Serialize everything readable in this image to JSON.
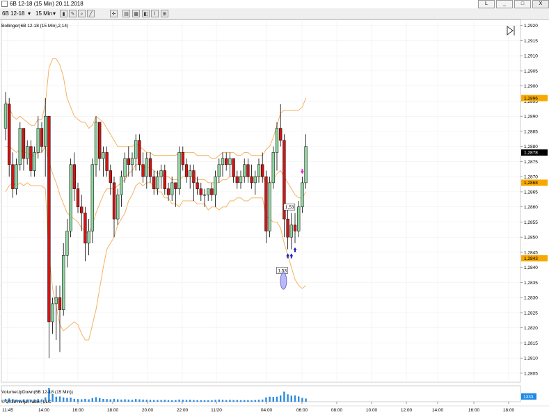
{
  "window": {
    "title": "6B 12-18 (15 Min)  20.11.2018",
    "controls": [
      "L",
      "_",
      "□",
      "X"
    ]
  },
  "toolbar": {
    "instrument": "6B 12-18",
    "interval": "15 Min"
  },
  "colors": {
    "up": "#8fd4a0",
    "down": "#d01414",
    "band": "#f5b262",
    "price_tag": "#f7a900",
    "last_tag": "#000000",
    "volume": "#2f8ae0",
    "volume_tag": "#1c8ae6",
    "up_arrow": "#2020c0",
    "down_arrow": "#e020e0"
  },
  "chart_data": [
    {
      "type": "candlestick",
      "indicator_label": "Bollinger(6B 12-18 (15 Min),2,14)",
      "ylim": [
        1.2802,
        1.2922
      ],
      "y_ticks": [
        "1,2920",
        "1,2915",
        "1,2910",
        "1,2905",
        "1,2900",
        "1,2895",
        "1,2890",
        "1,2885",
        "1,2880",
        "1,2875",
        "1,2870",
        "1,2865",
        "1,2860",
        "1,2855",
        "1,2850",
        "1,2845",
        "1,2840",
        "1,2835",
        "1,2830",
        "1,2825",
        "1,2820",
        "1,2815",
        "1,2810",
        "1,2805"
      ],
      "x_ticks": [
        "11:45",
        "14:00",
        "16:00",
        "18:00",
        "20:00",
        "22:00",
        "11/20",
        "04:00",
        "06:00",
        "08:00",
        "10:00",
        "12:00",
        "14:00",
        "16:00",
        "18:00"
      ],
      "price_tags": {
        "upper_band": "1,2896",
        "middle_band": "1,2868",
        "lower_band": "1,2843",
        "last": "1,2878"
      },
      "order_labels": [
        "1,53",
        "1,53"
      ],
      "candles": [
        [
          1.2886,
          1.2898,
          1.2882,
          1.2894
        ],
        [
          1.2894,
          1.2896,
          1.287,
          1.2874
        ],
        [
          1.2874,
          1.2878,
          1.2863,
          1.2866
        ],
        [
          1.2866,
          1.2876,
          1.2864,
          1.2874
        ],
        [
          1.2874,
          1.2888,
          1.2872,
          1.2886
        ],
        [
          1.2886,
          1.2886,
          1.2872,
          1.2876
        ],
        [
          1.2876,
          1.2882,
          1.2874,
          1.288
        ],
        [
          1.288,
          1.2882,
          1.287,
          1.2872
        ],
        [
          1.2872,
          1.288,
          1.287,
          1.2878
        ],
        [
          1.2878,
          1.289,
          1.2876,
          1.2886
        ],
        [
          1.2886,
          1.2888,
          1.2878,
          1.288
        ],
        [
          1.288,
          1.2896,
          1.287,
          1.289
        ],
        [
          1.289,
          1.289,
          1.281,
          1.2822
        ],
        [
          1.2822,
          1.283,
          1.2818,
          1.2828
        ],
        [
          1.2828,
          1.2834,
          1.2816,
          1.283
        ],
        [
          1.283,
          1.2834,
          1.2812,
          1.2826
        ],
        [
          1.2826,
          1.2848,
          1.2824,
          1.2844
        ],
        [
          1.2844,
          1.2856,
          1.284,
          1.2852
        ],
        [
          1.2852,
          1.2876,
          1.285,
          1.2874
        ],
        [
          1.2874,
          1.2878,
          1.2862,
          1.2866
        ],
        [
          1.2866,
          1.2868,
          1.2858,
          1.286
        ],
        [
          1.286,
          1.2864,
          1.2852,
          1.2858
        ],
        [
          1.2858,
          1.286,
          1.2842,
          1.2848
        ],
        [
          1.2848,
          1.2856,
          1.2844,
          1.2852
        ],
        [
          1.2852,
          1.2876,
          1.2848,
          1.2874
        ],
        [
          1.2874,
          1.289,
          1.287,
          1.2888
        ],
        [
          1.2888,
          1.2888,
          1.2872,
          1.2876
        ],
        [
          1.2876,
          1.288,
          1.287,
          1.2878
        ],
        [
          1.2878,
          1.288,
          1.287,
          1.2872
        ],
        [
          1.2872,
          1.2874,
          1.2864,
          1.2868
        ],
        [
          1.2868,
          1.287,
          1.285,
          1.2856
        ],
        [
          1.2856,
          1.2866,
          1.2854,
          1.2864
        ],
        [
          1.2864,
          1.2872,
          1.286,
          1.287
        ],
        [
          1.287,
          1.2878,
          1.2868,
          1.2876
        ],
        [
          1.2876,
          1.288,
          1.287,
          1.2874
        ],
        [
          1.2874,
          1.2878,
          1.287,
          1.2876
        ],
        [
          1.2876,
          1.2884,
          1.2872,
          1.2882
        ],
        [
          1.2882,
          1.2884,
          1.2872,
          1.2874
        ],
        [
          1.2874,
          1.2878,
          1.2868,
          1.287
        ],
        [
          1.287,
          1.2878,
          1.2866,
          1.2876
        ],
        [
          1.2876,
          1.2878,
          1.2868,
          1.287
        ],
        [
          1.287,
          1.2872,
          1.2864,
          1.2866
        ],
        [
          1.2866,
          1.2872,
          1.2864,
          1.287
        ],
        [
          1.287,
          1.2874,
          1.2866,
          1.2872
        ],
        [
          1.2872,
          1.2874,
          1.2864,
          1.2866
        ],
        [
          1.2866,
          1.2868,
          1.2862,
          1.2864
        ],
        [
          1.2864,
          1.287,
          1.2862,
          1.2868
        ],
        [
          1.2868,
          1.2868,
          1.286,
          1.2866
        ],
        [
          1.2866,
          1.288,
          1.2864,
          1.2878
        ],
        [
          1.2878,
          1.288,
          1.2872,
          1.2874
        ],
        [
          1.2874,
          1.2876,
          1.2868,
          1.287
        ],
        [
          1.287,
          1.2874,
          1.2866,
          1.2872
        ],
        [
          1.2872,
          1.2874,
          1.2862,
          1.2868
        ],
        [
          1.2868,
          1.287,
          1.2864,
          1.2866
        ],
        [
          1.2866,
          1.2868,
          1.2862,
          1.2864
        ],
        [
          1.2864,
          1.2866,
          1.286,
          1.2864
        ],
        [
          1.2864,
          1.2866,
          1.2862,
          1.2866
        ],
        [
          1.2866,
          1.2868,
          1.2862,
          1.2864
        ],
        [
          1.2864,
          1.2872,
          1.286,
          1.287
        ],
        [
          1.287,
          1.2876,
          1.2868,
          1.2874
        ],
        [
          1.2874,
          1.2878,
          1.287,
          1.2876
        ],
        [
          1.2876,
          1.2878,
          1.2872,
          1.2874
        ],
        [
          1.2874,
          1.2878,
          1.287,
          1.2876
        ],
        [
          1.2876,
          1.2876,
          1.2868,
          1.287
        ],
        [
          1.287,
          1.2872,
          1.2866,
          1.2868
        ],
        [
          1.2868,
          1.2872,
          1.2866,
          1.287
        ],
        [
          1.287,
          1.2876,
          1.2868,
          1.2874
        ],
        [
          1.2874,
          1.2876,
          1.2868,
          1.287
        ],
        [
          1.287,
          1.2874,
          1.2866,
          1.2868
        ],
        [
          1.2868,
          1.2872,
          1.2864,
          1.287
        ],
        [
          1.287,
          1.2876,
          1.2868,
          1.2874
        ],
        [
          1.2874,
          1.2878,
          1.2868,
          1.287
        ],
        [
          1.287,
          1.2872,
          1.2848,
          1.2852
        ],
        [
          1.2852,
          1.287,
          1.285,
          1.2868
        ],
        [
          1.2868,
          1.288,
          1.2866,
          1.2878
        ],
        [
          1.2878,
          1.2888,
          1.2872,
          1.2886
        ],
        [
          1.2886,
          1.2894,
          1.288,
          1.2882
        ],
        [
          1.2882,
          1.2884,
          1.285,
          1.2856
        ],
        [
          1.2856,
          1.286,
          1.2846,
          1.285
        ],
        [
          1.285,
          1.2858,
          1.2846,
          1.2854
        ],
        [
          1.2854,
          1.2858,
          1.2848,
          1.2852
        ],
        [
          1.2852,
          1.2862,
          1.285,
          1.286
        ],
        [
          1.286,
          1.287,
          1.2858,
          1.2868
        ],
        [
          1.2868,
          1.2884,
          1.2866,
          1.288
        ]
      ],
      "upper_band": [
        1.2895,
        1.2893,
        1.289,
        1.2889,
        1.289,
        1.2889,
        1.2888,
        1.2887,
        1.2887,
        1.2889,
        1.2889,
        1.2894,
        1.2906,
        1.2909,
        1.2909,
        1.2907,
        1.2903,
        1.2896,
        1.2893,
        1.289,
        1.2889,
        1.2888,
        1.2888,
        1.2886,
        1.2887,
        1.289,
        1.2889,
        1.2888,
        1.2886,
        1.2884,
        1.2882,
        1.288,
        1.288,
        1.288,
        1.288,
        1.288,
        1.2881,
        1.288,
        1.2879,
        1.2878,
        1.2878,
        1.2877,
        1.2877,
        1.2877,
        1.2877,
        1.2877,
        1.2877,
        1.2877,
        1.2878,
        1.2878,
        1.2878,
        1.2878,
        1.2878,
        1.2877,
        1.2877,
        1.2877,
        1.2877,
        1.2876,
        1.2876,
        1.2877,
        1.2878,
        1.2878,
        1.2878,
        1.2878,
        1.2877,
        1.2877,
        1.2878,
        1.2878,
        1.2877,
        1.2877,
        1.2877,
        1.2877,
        1.2879,
        1.288,
        1.2883,
        1.2887,
        1.2891,
        1.2892,
        1.2892,
        1.2892,
        1.2892,
        1.2892,
        1.2893,
        1.2896
      ],
      "middle_band": [
        1.288,
        1.288,
        1.2879,
        1.2878,
        1.2879,
        1.2878,
        1.2878,
        1.2877,
        1.2877,
        1.2878,
        1.2878,
        1.288,
        1.2875,
        1.2871,
        1.2868,
        1.2864,
        1.2861,
        1.2858,
        1.2857,
        1.2856,
        1.2855,
        1.2853,
        1.2852,
        1.2851,
        1.2854,
        1.2858,
        1.2861,
        1.2864,
        1.2866,
        1.2866,
        1.2866,
        1.2867,
        1.2868,
        1.2869,
        1.2871,
        1.2872,
        1.2874,
        1.2874,
        1.2873,
        1.2873,
        1.2873,
        1.2872,
        1.2871,
        1.2871,
        1.287,
        1.287,
        1.2869,
        1.2869,
        1.2869,
        1.287,
        1.287,
        1.287,
        1.287,
        1.2869,
        1.2869,
        1.2869,
        1.2868,
        1.2868,
        1.2868,
        1.2868,
        1.2869,
        1.2869,
        1.287,
        1.287,
        1.287,
        1.287,
        1.287,
        1.287,
        1.287,
        1.287,
        1.287,
        1.287,
        1.2868,
        1.2868,
        1.2869,
        1.2871,
        1.2872,
        1.287,
        1.2868,
        1.2866,
        1.2864,
        1.2863,
        1.2863,
        1.2865
      ],
      "lower_band": [
        1.2865,
        1.2867,
        1.2868,
        1.2867,
        1.2868,
        1.2867,
        1.2868,
        1.2867,
        1.2867,
        1.2867,
        1.2867,
        1.2866,
        1.2844,
        1.2833,
        1.2827,
        1.2821,
        1.2819,
        1.282,
        1.2821,
        1.2822,
        1.2821,
        1.2818,
        1.2816,
        1.2816,
        1.2821,
        1.2826,
        1.2833,
        1.284,
        1.2846,
        1.2848,
        1.285,
        1.2854,
        1.2856,
        1.2858,
        1.2862,
        1.2864,
        1.2867,
        1.2868,
        1.2867,
        1.2868,
        1.2868,
        1.2867,
        1.2865,
        1.2865,
        1.2863,
        1.2863,
        1.2861,
        1.2861,
        1.286,
        1.2862,
        1.2862,
        1.2862,
        1.2862,
        1.2861,
        1.2861,
        1.2861,
        1.2859,
        1.286,
        1.286,
        1.2859,
        1.286,
        1.286,
        1.2862,
        1.2862,
        1.2863,
        1.2863,
        1.2862,
        1.2862,
        1.2863,
        1.2863,
        1.2863,
        1.2863,
        1.2857,
        1.2856,
        1.2855,
        1.2855,
        1.2853,
        1.2848,
        1.2844,
        1.284,
        1.2836,
        1.2834,
        1.2833,
        1.2834
      ],
      "up_arrows": [
        78,
        79,
        80
      ],
      "down_arrows": [
        79,
        82
      ]
    },
    {
      "type": "bar",
      "indicator_label": "VolumeUpDown(6B 12-18 (15 Min))",
      "last_value": "1333",
      "values": [
        1200,
        1350,
        1100,
        900,
        800,
        1000,
        950,
        900,
        1000,
        1100,
        1000,
        1800,
        5800,
        3200,
        2100,
        2200,
        1800,
        1600,
        1700,
        1200,
        1100,
        1000,
        1200,
        1000,
        1500,
        1900,
        1500,
        1200,
        1100,
        1000,
        1200,
        1000,
        900,
        1000,
        900,
        800,
        1100,
        1000,
        900,
        850,
        800,
        700,
        700,
        700,
        800,
        650,
        600,
        700,
        900,
        800,
        750,
        800,
        700,
        650,
        600,
        650,
        600,
        600,
        800,
        900,
        800,
        700,
        800,
        700,
        700,
        650,
        700,
        650,
        600,
        700,
        850,
        900,
        1800,
        2100,
        2000,
        2100,
        2600,
        4200,
        3100,
        2500,
        2600,
        2200,
        1600,
        1333
      ]
    }
  ],
  "copyright": "© 2018 NinjaTrader, LLC"
}
